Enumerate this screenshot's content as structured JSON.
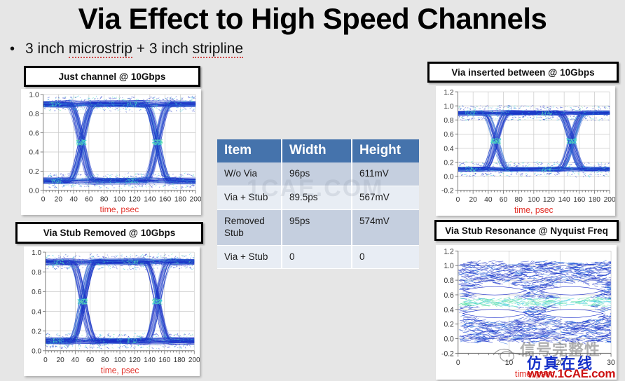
{
  "slide": {
    "title": "Via Effect to High Speed Channels",
    "bullet_marker": "•",
    "bullet_pre": "3 inch ",
    "bullet_word1": "microstrip",
    "bullet_mid": " + 3 inch ",
    "bullet_word2": "stripline",
    "background_color": "#e6e6e6"
  },
  "captions": {
    "top_left": "Just channel @ 10Gbps",
    "top_right": "Via inserted between @ 10Gbps",
    "bottom_left": "Via Stub Removed @ 10Gbps",
    "bottom_right": "Via Stub Resonance @ Nyquist Freq"
  },
  "table": {
    "headers": [
      "Item",
      "Width",
      "Height"
    ],
    "header_color": "#4573ac",
    "row_odd_color": "#c5cfdf",
    "row_even_color": "#e8edf4",
    "rows": [
      {
        "item": "W/o Via",
        "width": "96ps",
        "height": "611mV"
      },
      {
        "item": "Via + Stub",
        "width": "89.5ps",
        "height": "567mV"
      },
      {
        "item": "Removed Stub",
        "width": "95ps",
        "height": "574mV"
      },
      {
        "item": "Via + Stub",
        "width": "0",
        "height": "0"
      }
    ]
  },
  "watermarks": {
    "center": "1CAE.COM",
    "cn_gray": "信号完整性",
    "cn_blue": "仿真在线",
    "url": "www.1CAE.com"
  },
  "chart_data": [
    {
      "id": "top_left",
      "type": "line",
      "title": "Just channel @ 10Gbps",
      "xlabel": "time, psec",
      "ylabel": "",
      "xlim": [
        0,
        200
      ],
      "ylim": [
        0.0,
        1.0
      ],
      "xticks": [
        0,
        20,
        40,
        60,
        80,
        100,
        120,
        140,
        160,
        180,
        200
      ],
      "yticks": [
        0.0,
        0.2,
        0.4,
        0.6,
        0.8,
        1.0
      ],
      "grid": true,
      "eye_crossings": [
        50,
        150
      ],
      "eye_width_ps": 96,
      "eye_height_mv": 611,
      "high_level": 0.9,
      "low_level": 0.1,
      "trace_color": "#1a32c8",
      "density_color": "#35d3b0",
      "axis_label_color": "#e2322a"
    },
    {
      "id": "top_right",
      "type": "line",
      "title": "Via inserted between @ 10Gbps",
      "xlabel": "time, psec",
      "ylabel": "",
      "xlim": [
        0,
        200
      ],
      "ylim": [
        -0.2,
        1.2
      ],
      "xticks": [
        0,
        20,
        40,
        60,
        80,
        100,
        120,
        140,
        160,
        180,
        200
      ],
      "yticks": [
        -0.2,
        0.0,
        0.2,
        0.4,
        0.6,
        0.8,
        1.0,
        1.2
      ],
      "grid": true,
      "eye_crossings": [
        50,
        150
      ],
      "eye_width_ps": 89.5,
      "eye_height_mv": 567,
      "high_level": 0.9,
      "low_level": 0.1,
      "trace_color": "#1a32c8",
      "density_color": "#35d3b0",
      "axis_label_color": "#e2322a"
    },
    {
      "id": "bottom_left",
      "type": "line",
      "title": "Via Stub Removed @ 10Gbps",
      "xlabel": "time, psec",
      "ylabel": "",
      "xlim": [
        0,
        200
      ],
      "ylim": [
        0.0,
        1.0
      ],
      "xticks": [
        0,
        20,
        40,
        60,
        80,
        100,
        120,
        140,
        160,
        180,
        200
      ],
      "yticks": [
        0.0,
        0.2,
        0.4,
        0.6,
        0.8,
        1.0
      ],
      "grid": true,
      "eye_crossings": [
        50,
        150
      ],
      "eye_width_ps": 95,
      "eye_height_mv": 574,
      "high_level": 0.9,
      "low_level": 0.1,
      "trace_color": "#1a32c8",
      "density_color": "#35d3b0",
      "axis_label_color": "#e2322a"
    },
    {
      "id": "bottom_right",
      "type": "line",
      "title": "Via Stub Resonance @ Nyquist Freq",
      "xlabel": "time, psec",
      "ylabel": "",
      "xlim": [
        0,
        30
      ],
      "ylim": [
        -0.2,
        1.2
      ],
      "xticks": [
        0,
        10,
        20,
        30
      ],
      "yticks": [
        -0.2,
        0.0,
        0.2,
        0.4,
        0.6,
        0.8,
        1.0,
        1.2
      ],
      "grid": true,
      "eye_crossings": [
        7.5,
        22.5
      ],
      "eye_width_ps": 0,
      "eye_height_mv": 0,
      "high_level": 0.75,
      "low_level": 0.25,
      "trace_color": "#1a32c8",
      "density_color": "#35d3b0",
      "axis_label_color": "#e2322a"
    }
  ]
}
